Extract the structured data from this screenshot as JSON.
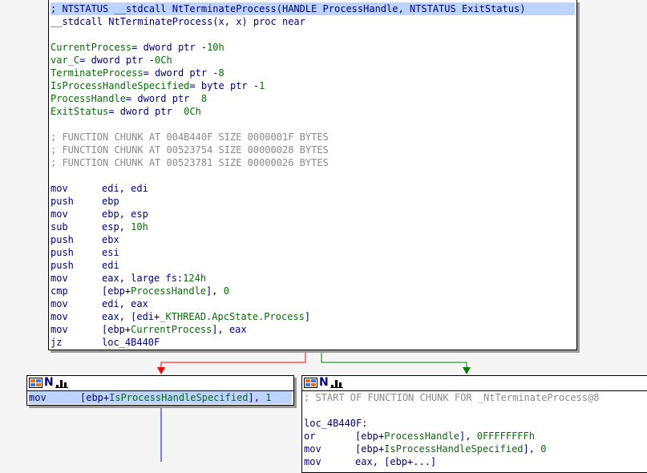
{
  "main_block": {
    "lines": [
      {
        "kind": "decl",
        "text": "; NTSTATUS __stdcall NtTerminateProcess(HANDLE ProcessHandle, NTSTATUS ExitStatus)"
      },
      {
        "kind": "decl",
        "text": "__stdcall NtTerminateProcess(x, x) proc near"
      },
      {
        "kind": "blank",
        "text": ""
      },
      {
        "kind": "var",
        "name": "CurrentProcess",
        "rest": "= dword ptr -10h"
      },
      {
        "kind": "var",
        "name": "var_C",
        "rest": "= dword ptr -0Ch"
      },
      {
        "kind": "var",
        "name": "TerminateProcess",
        "rest": "= dword ptr -8"
      },
      {
        "kind": "var",
        "name": "IsProcessHandleSpecified",
        "rest": "= byte ptr -1"
      },
      {
        "kind": "var",
        "name": "ProcessHandle",
        "rest": "= dword ptr  8"
      },
      {
        "kind": "var",
        "name": "ExitStatus",
        "rest": "= dword ptr  0Ch"
      },
      {
        "kind": "blank",
        "text": ""
      },
      {
        "kind": "comment",
        "text": "; FUNCTION CHUNK AT 004B440F SIZE 0000001F BYTES"
      },
      {
        "kind": "comment",
        "text": "; FUNCTION CHUNK AT 00523754 SIZE 00000028 BYTES"
      },
      {
        "kind": "comment",
        "text": "; FUNCTION CHUNK AT 00523781 SIZE 00000026 BYTES"
      },
      {
        "kind": "blank",
        "text": ""
      },
      {
        "kind": "ins",
        "mn": "mov",
        "op": "edi, edi"
      },
      {
        "kind": "ins",
        "mn": "push",
        "op": "ebp"
      },
      {
        "kind": "ins",
        "mn": "mov",
        "op": "ebp, esp"
      },
      {
        "kind": "ins",
        "mn": "sub",
        "op": "esp, 10h"
      },
      {
        "kind": "ins",
        "mn": "push",
        "op": "ebx"
      },
      {
        "kind": "ins",
        "mn": "push",
        "op": "esi"
      },
      {
        "kind": "ins",
        "mn": "push",
        "op": "edi"
      },
      {
        "kind": "ins",
        "mn": "mov",
        "op": "eax, large fs:124h"
      },
      {
        "kind": "ins",
        "mn": "cmp",
        "op": "[ebp+ProcessHandle], 0"
      },
      {
        "kind": "ins",
        "mn": "mov",
        "op": "edi, eax"
      },
      {
        "kind": "ins",
        "mn": "mov",
        "op": "eax, [edi+_KTHREAD.ApcState.Process]"
      },
      {
        "kind": "ins",
        "mn": "mov",
        "op": "[ebp+CurrentProcess], eax"
      },
      {
        "kind": "ins",
        "mn": "jz",
        "op": "loc_4B440F"
      }
    ]
  },
  "left_block": {
    "lines": [
      {
        "kind": "ins",
        "mn": "mov",
        "op": "[ebp+IsProcessHandleSpecified], 1"
      }
    ]
  },
  "right_block": {
    "lines": [
      {
        "kind": "comment",
        "text": "; START OF FUNCTION CHUNK FOR _NtTerminateProcess@8"
      },
      {
        "kind": "blank",
        "text": ""
      },
      {
        "kind": "label",
        "text": "loc_4B440F:"
      },
      {
        "kind": "ins",
        "mn": "or",
        "op": "[ebp+ProcessHandle], 0FFFFFFFFh"
      },
      {
        "kind": "ins",
        "mn": "mov",
        "op": "[ebp+IsProcessHandleSpecified], 0"
      },
      {
        "kind": "ins",
        "mn": "mov",
        "op": "eax, [ebp+...]"
      }
    ]
  },
  "colors": {
    "edge_false": "#ff0000",
    "edge_true": "#007f00",
    "edge_uncond": "#0000ff",
    "selection": "#bcd4ff",
    "code_text": "#000080",
    "name_text": "#0a6b0a",
    "comment_text": "#8a8a8a"
  },
  "icons": [
    "graph-grid-icon",
    "node-n-icon",
    "node-bars-icon"
  ]
}
